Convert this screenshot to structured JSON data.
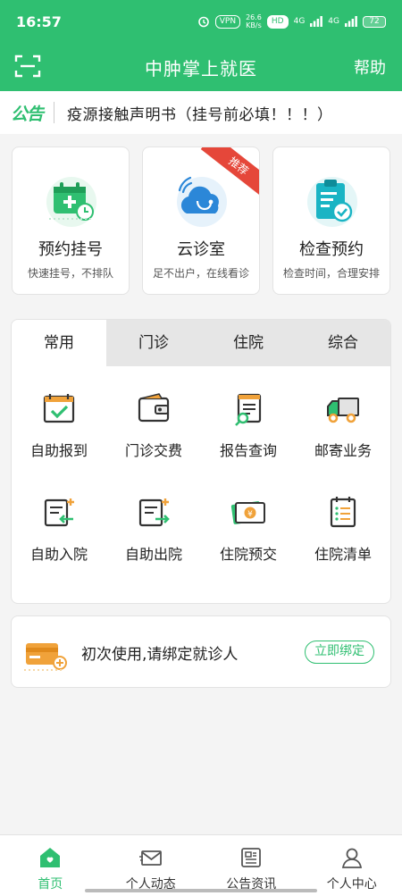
{
  "status": {
    "time": "16:57",
    "vpn": "VPN",
    "speed": "26.6",
    "speed_unit": "KB/s",
    "hd": "HD",
    "net1": "4G",
    "net2": "4G",
    "battery": "72"
  },
  "header": {
    "title": "中肿掌上就医",
    "help": "帮助",
    "scan_icon": "scan-icon"
  },
  "notice": {
    "tag": "公告",
    "text": "疫源接触声明书（挂号前必填！！！）"
  },
  "cards": [
    {
      "title": "预约挂号",
      "subtitle": "快速挂号，不排队",
      "icon": "calendar-add-icon"
    },
    {
      "title": "云诊室",
      "subtitle": "足不出户，在线看诊",
      "icon": "cloud-stethoscope-icon",
      "badge": "推荐"
    },
    {
      "title": "检查预约",
      "subtitle": "检查时间，合理安排",
      "icon": "clipboard-check-icon"
    }
  ],
  "services": {
    "tabs": [
      "常用",
      "门诊",
      "住院",
      "综合"
    ],
    "active_tab": "常用",
    "items": [
      {
        "label": "自助报到",
        "icon": "calendar-check-icon"
      },
      {
        "label": "门诊交费",
        "icon": "wallet-icon"
      },
      {
        "label": "报告查询",
        "icon": "report-search-icon"
      },
      {
        "label": "邮寄业务",
        "icon": "truck-icon"
      },
      {
        "label": "自助入院",
        "icon": "admission-icon"
      },
      {
        "label": "自助出院",
        "icon": "discharge-icon"
      },
      {
        "label": "住院预交",
        "icon": "money-icon"
      },
      {
        "label": "住院清单",
        "icon": "list-icon"
      }
    ]
  },
  "bind_patient": {
    "text": "初次使用,请绑定就诊人",
    "button": "立即绑定",
    "icon": "id-card-icon"
  },
  "tabbar": [
    {
      "label": "首页",
      "icon": "home-icon",
      "active": true
    },
    {
      "label": "个人动态",
      "icon": "mail-icon",
      "active": false
    },
    {
      "label": "公告资讯",
      "icon": "news-icon",
      "active": false
    },
    {
      "label": "个人中心",
      "icon": "user-icon",
      "active": false
    }
  ],
  "colors": {
    "brand": "#2fbf71",
    "badge": "#e5473a"
  }
}
